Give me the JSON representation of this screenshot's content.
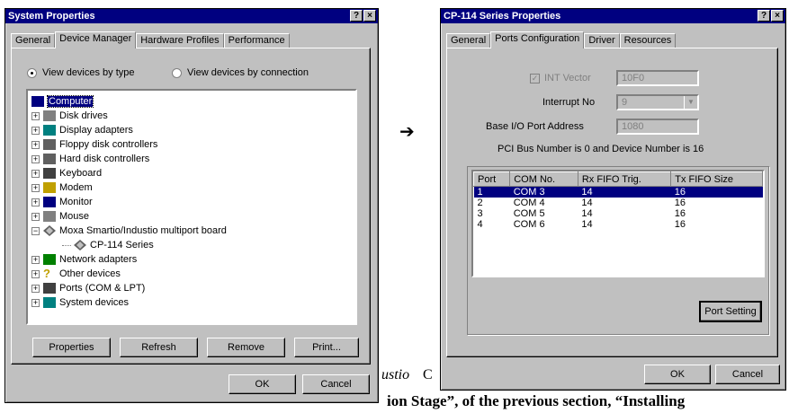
{
  "left_window": {
    "title": "System Properties",
    "title_buttons": [
      "?",
      "×"
    ],
    "tabs": [
      "General",
      "Device Manager",
      "Hardware Profiles",
      "Performance"
    ],
    "radio_by_type": "View devices by type",
    "radio_by_connection": "View devices by connection",
    "tree": [
      {
        "label": "Computer",
        "icon": "computer-icon",
        "selected": true
      },
      {
        "label": "Disk drives",
        "icon": "disk-drive-icon",
        "exp": "+"
      },
      {
        "label": "Display adapters",
        "icon": "display-icon",
        "exp": "+"
      },
      {
        "label": "Floppy disk controllers",
        "icon": "floppy-controller-icon",
        "exp": "+"
      },
      {
        "label": "Hard disk controllers",
        "icon": "hdd-controller-icon",
        "exp": "+"
      },
      {
        "label": "Keyboard",
        "icon": "keyboard-icon",
        "exp": "+"
      },
      {
        "label": "Modem",
        "icon": "modem-icon",
        "exp": "+"
      },
      {
        "label": "Monitor",
        "icon": "monitor-icon",
        "exp": "+"
      },
      {
        "label": "Mouse",
        "icon": "mouse-icon",
        "exp": "+"
      },
      {
        "label": "Moxa Smartio/Industio multiport board",
        "icon": "multiport-board-icon",
        "exp": "−"
      },
      {
        "label": "CP-114 Series",
        "icon": "multiport-board-icon",
        "child": true
      },
      {
        "label": "Network adapters",
        "icon": "network-icon",
        "exp": "+"
      },
      {
        "label": "Other devices",
        "icon": "question-icon",
        "exp": "+"
      },
      {
        "label": "Ports (COM & LPT)",
        "icon": "port-icon",
        "exp": "+"
      },
      {
        "label": "System devices",
        "icon": "system-icon",
        "exp": "+"
      }
    ],
    "buttons": {
      "properties": "Properties",
      "refresh": "Refresh",
      "remove": "Remove",
      "print": "Print...",
      "ok": "OK",
      "cancel": "Cancel"
    }
  },
  "arrow": "➔",
  "background_text": {
    "italic_fragment": "ustio",
    "c_fragment": "C",
    "bottom_line": "ion Stage”, of the previous section, “Installing"
  },
  "right_window": {
    "title": "CP-114 Series Properties",
    "title_buttons": [
      "?",
      "×"
    ],
    "tabs": [
      "General",
      "Ports Configuration",
      "Driver",
      "Resources"
    ],
    "int_vector_label": "INT Vector",
    "int_vector_value": "10F0",
    "interrupt_label": "Interrupt No",
    "interrupt_value": "9",
    "base_io_label": "Base I/O Port Address",
    "base_io_value": "1080",
    "pci_info": "PCI Bus Number is 0 and Device Number is 16",
    "table": {
      "headers": [
        "Port",
        "COM No.",
        "Rx FIFO Trig.",
        "Tx FIFO Size"
      ],
      "rows": [
        [
          "1",
          "COM 3",
          "14",
          "16"
        ],
        [
          "2",
          "COM 4",
          "14",
          "16"
        ],
        [
          "3",
          "COM 5",
          "14",
          "16"
        ],
        [
          "4",
          "COM 6",
          "14",
          "16"
        ]
      ]
    },
    "buttons": {
      "port_setting": "Port Setting",
      "ok": "OK",
      "cancel": "Cancel"
    }
  }
}
